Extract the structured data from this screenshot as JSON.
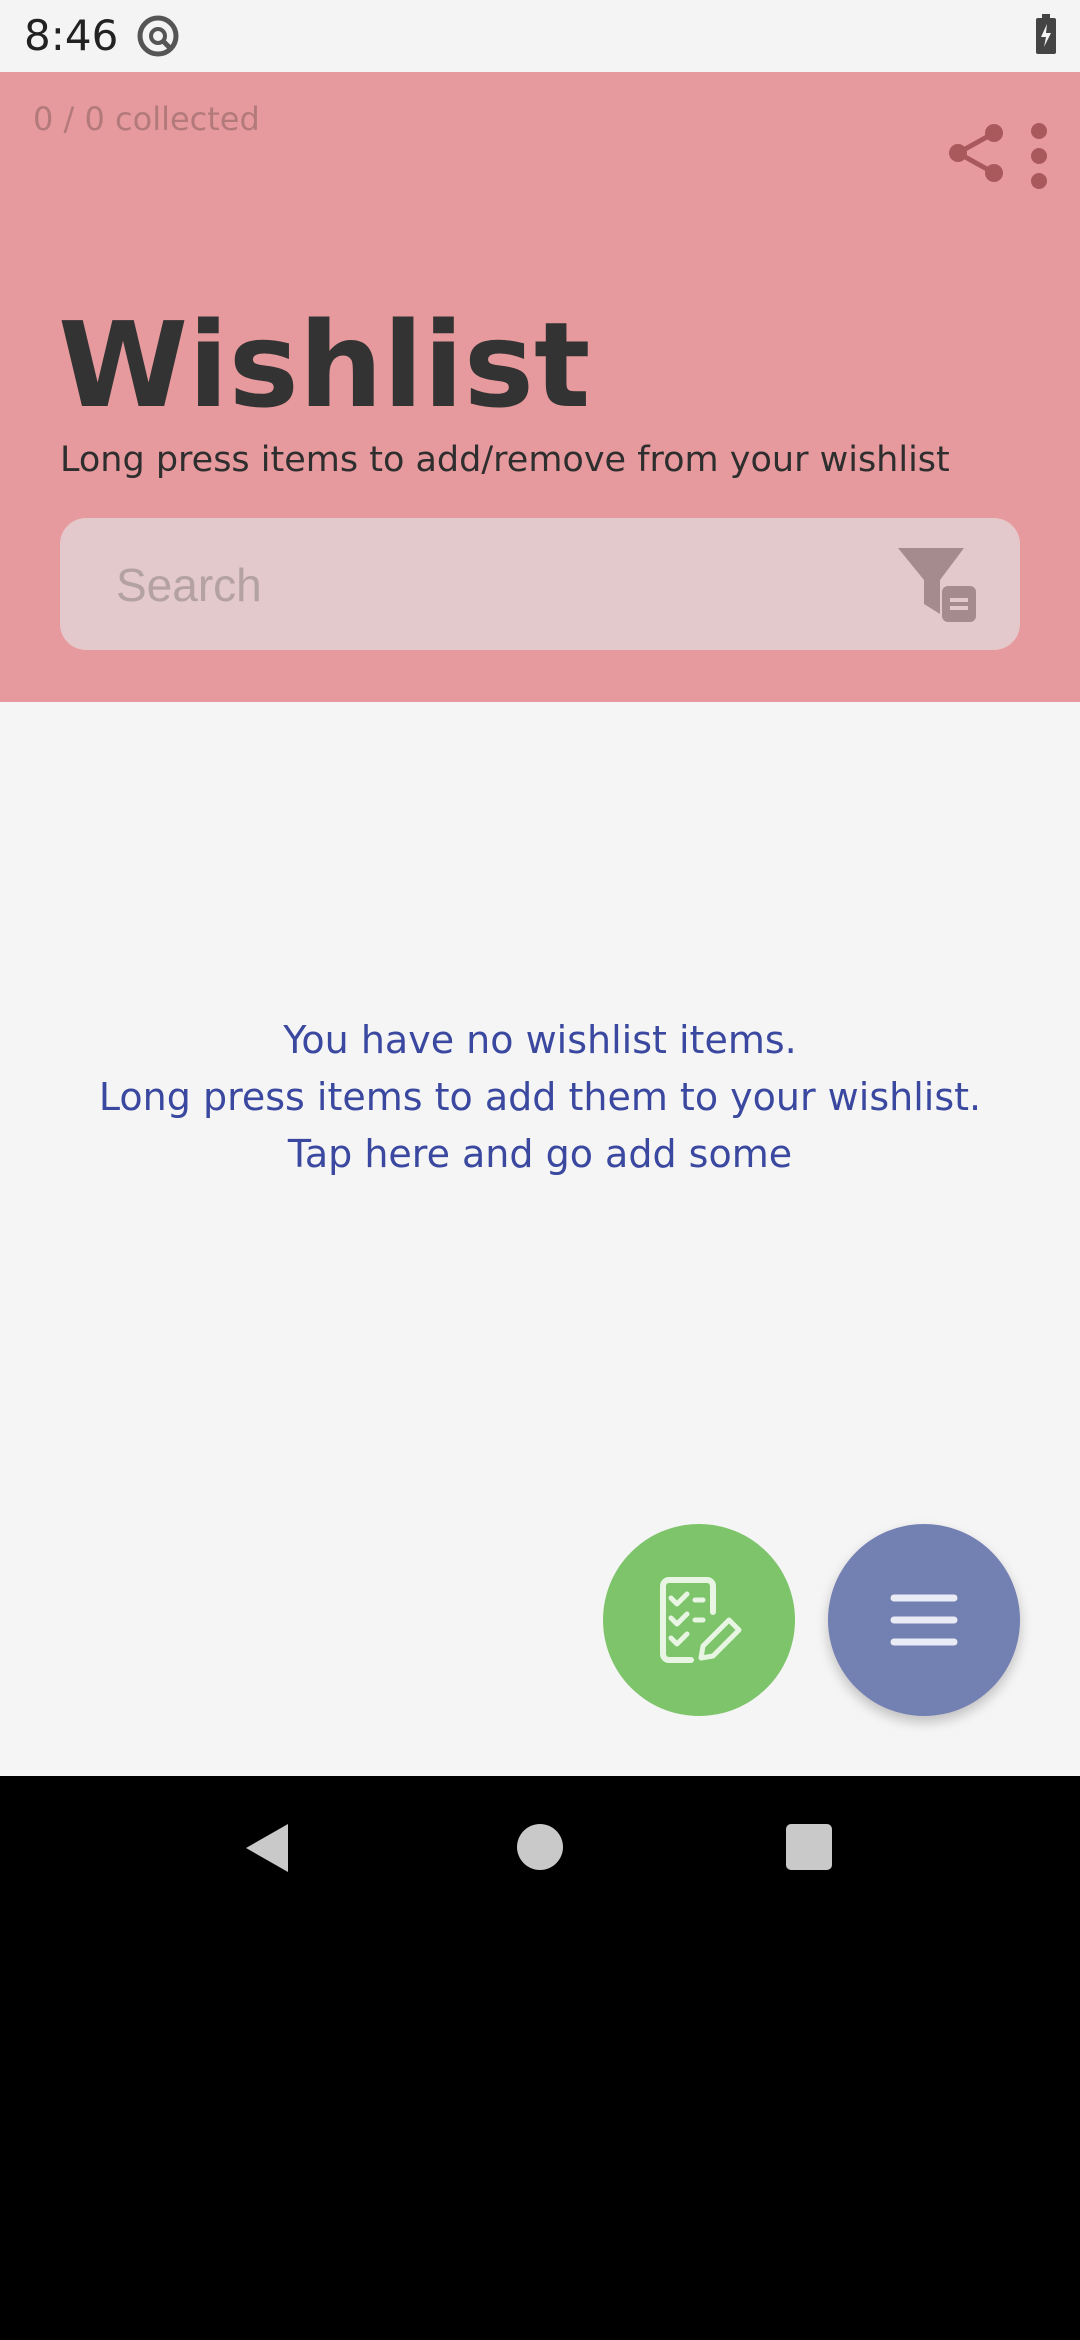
{
  "status_bar": {
    "time": "8:46"
  },
  "header": {
    "collected": "0 / 0 collected",
    "title": "Wishlist",
    "subtitle": "Long press items to add/remove from your wishlist",
    "search_placeholder": "Search",
    "icons": [
      "share-icon",
      "more-vert-icon",
      "filter-icon"
    ]
  },
  "content": {
    "empty_lines": [
      "You have no wishlist items.",
      "Long press items to add them to your wishlist.",
      "Tap here and go add some"
    ]
  },
  "fabs": {
    "checklist_icon": "checklist-edit-icon",
    "menu_icon": "menu-icon"
  },
  "nav": [
    "back",
    "home",
    "recents"
  ],
  "colors": {
    "header_bg": "#e69a9d",
    "content_bg": "#f5f5f5",
    "accent_text": "#3a48a0",
    "fab_green": "#7ec46b",
    "fab_blue": "#7380b2"
  }
}
